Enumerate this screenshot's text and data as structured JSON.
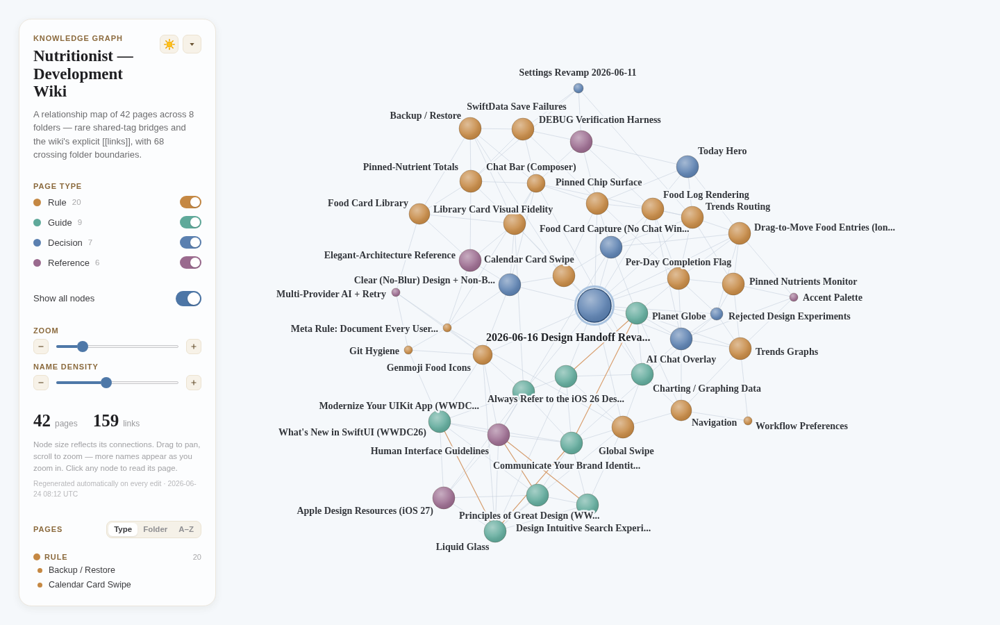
{
  "sidebar": {
    "eyebrow": "KNOWLEDGE GRAPH",
    "title": "Nutritionist — Development Wiki",
    "description": "A relationship map of 42 pages across 8 folders — rare shared-tag bridges and the wiki's explicit [[links]], with 68 crossing folder boundaries.",
    "page_type": {
      "heading": "PAGE TYPE",
      "items": [
        {
          "kind": "rule",
          "label": "Rule",
          "count": "20",
          "color": "#c58843",
          "on": true
        },
        {
          "kind": "guide",
          "label": "Guide",
          "count": "9",
          "color": "#5fa99a",
          "on": true
        },
        {
          "kind": "decision",
          "label": "Decision",
          "count": "7",
          "color": "#5b80b0",
          "on": true
        },
        {
          "kind": "reference",
          "label": "Reference",
          "count": "6",
          "color": "#9a6a8e",
          "on": true
        }
      ]
    },
    "show_all_nodes": {
      "label": "Show all nodes",
      "on": true
    },
    "sliders": [
      {
        "label": "ZOOM",
        "level": 0.21
      },
      {
        "label": "NAME DENSITY",
        "level": 0.41
      }
    ],
    "stats": [
      {
        "value": "42",
        "unit": "pages"
      },
      {
        "value": "159",
        "unit": "links"
      }
    ],
    "note": "Node size reflects its connections. Drag to pan, scroll to zoom — more names appear as you zoom in. Click any node to read its page.",
    "regenerated": "Regenerated automatically on every edit · 2026-06-24 08:12 UTC",
    "pages": {
      "heading": "PAGES",
      "tabs": [
        {
          "label": "Type",
          "selected": true
        },
        {
          "label": "Folder",
          "selected": false
        },
        {
          "label": "A–Z",
          "selected": false
        }
      ],
      "groups": [
        {
          "kind": "rule",
          "label": "RULE",
          "count": "20",
          "items": [
            "Backup / Restore",
            "Calendar Card Swipe"
          ]
        }
      ]
    }
  },
  "graph": {
    "nodes": [
      {
        "label": "Settings Revamp 2026-06-11",
        "kind": "decision",
        "selected": false
      },
      {
        "label": "SwiftData Save Failures",
        "kind": "rule",
        "selected": false
      },
      {
        "label": "Backup / Restore",
        "kind": "rule",
        "selected": false
      },
      {
        "label": "DEBUG Verification Harness",
        "kind": "reference",
        "selected": false
      },
      {
        "label": "Today Hero",
        "kind": "decision",
        "selected": false
      },
      {
        "label": "Pinned-Nutrient Totals",
        "kind": "rule",
        "selected": false
      },
      {
        "label": "Chat Bar (Composer)",
        "kind": "rule",
        "selected": false
      },
      {
        "label": "Pinned Chip Surface",
        "kind": "rule",
        "selected": false
      },
      {
        "label": "Food Log Rendering",
        "kind": "rule",
        "selected": false
      },
      {
        "label": "Food Card Library",
        "kind": "rule",
        "selected": false
      },
      {
        "label": "Library Card Visual Fidelity",
        "kind": "rule",
        "selected": false
      },
      {
        "label": "Trends Routing",
        "kind": "rule",
        "selected": false
      },
      {
        "label": "Food Card Capture (No Chat Win...",
        "kind": "decision",
        "selected": false
      },
      {
        "label": "Drag-to-Move Food Entries (lon...",
        "kind": "rule",
        "selected": false
      },
      {
        "label": "Elegant-Architecture Reference",
        "kind": "reference",
        "selected": false
      },
      {
        "label": "Calendar Card Swipe",
        "kind": "rule",
        "selected": false
      },
      {
        "label": "Per-Day Completion Flag",
        "kind": "rule",
        "selected": false
      },
      {
        "label": "Clear (No-Blur) Design + Non-B...",
        "kind": "decision",
        "selected": false
      },
      {
        "label": "Pinned Nutrients Monitor",
        "kind": "rule",
        "selected": false
      },
      {
        "label": "Multi-Provider AI + Retry",
        "kind": "reference",
        "selected": false
      },
      {
        "label": "Accent Palette",
        "kind": "reference",
        "selected": false
      },
      {
        "label": "Planet Globe",
        "kind": "guide",
        "selected": false
      },
      {
        "label": "Rejected Design Experiments",
        "kind": "decision",
        "selected": false
      },
      {
        "label": "Meta Rule: Document Every User...",
        "kind": "rule",
        "selected": false
      },
      {
        "label": "2026-06-16 Design Handoff Reva...",
        "kind": "decision",
        "selected": true
      },
      {
        "label": "Git Hygiene",
        "kind": "rule",
        "selected": false
      },
      {
        "label": "Trends Graphs",
        "kind": "rule",
        "selected": false
      },
      {
        "label": "AI Chat Overlay",
        "kind": "decision",
        "selected": false
      },
      {
        "label": "Genmoji Food Icons",
        "kind": "rule",
        "selected": false
      },
      {
        "label": "Charting / Graphing Data",
        "kind": "guide",
        "selected": false
      },
      {
        "label": "Always Refer to the iOS 26 Des...",
        "kind": "guide",
        "selected": false
      },
      {
        "label": "Modernize Your UIKit App (WWDC...",
        "kind": "guide",
        "selected": false
      },
      {
        "label": "Navigation",
        "kind": "rule",
        "selected": false
      },
      {
        "label": "Workflow Preferences",
        "kind": "rule",
        "selected": false
      },
      {
        "label": "What's New in SwiftUI (WWDC26)",
        "kind": "guide",
        "selected": false
      },
      {
        "label": "Human Interface Guidelines",
        "kind": "reference",
        "selected": false
      },
      {
        "label": "Global Swipe",
        "kind": "rule",
        "selected": false
      },
      {
        "label": "Communicate Your Brand Identit...",
        "kind": "guide",
        "selected": false
      },
      {
        "label": "Apple Design Resources (iOS 27)",
        "kind": "reference",
        "selected": false
      },
      {
        "label": "Principles of Great Design (WW...",
        "kind": "guide",
        "selected": false
      },
      {
        "label": "Design Intuitive Search Experi...",
        "kind": "guide",
        "selected": false
      },
      {
        "label": "Liquid Glass",
        "kind": "guide",
        "selected": false
      }
    ]
  }
}
